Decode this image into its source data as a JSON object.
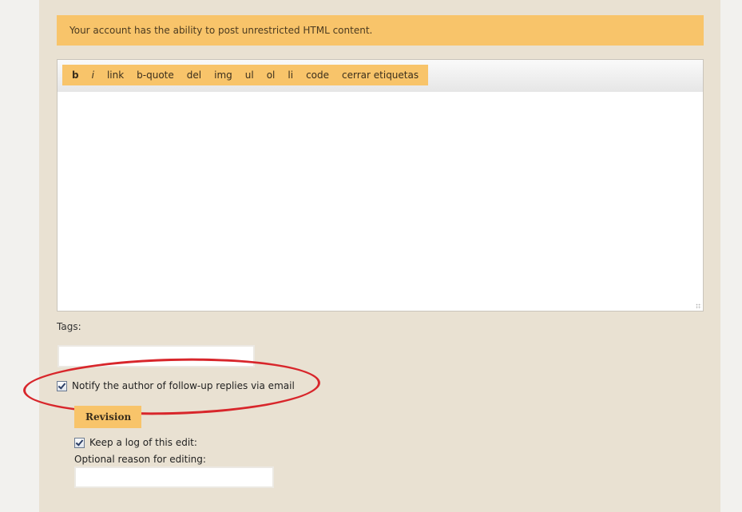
{
  "notice": {
    "text": "Your account has the ability to post unrestricted HTML content."
  },
  "toolbar": {
    "buttons": [
      {
        "label": "b",
        "name": "bold-button"
      },
      {
        "label": "i",
        "name": "italic-button"
      },
      {
        "label": "link",
        "name": "link-button"
      },
      {
        "label": "b-quote",
        "name": "blockquote-button"
      },
      {
        "label": "del",
        "name": "del-button"
      },
      {
        "label": "img",
        "name": "img-button"
      },
      {
        "label": "ul",
        "name": "ul-button"
      },
      {
        "label": "ol",
        "name": "ol-button"
      },
      {
        "label": "li",
        "name": "li-button"
      },
      {
        "label": "code",
        "name": "code-button"
      },
      {
        "label": "cerrar etiquetas",
        "name": "close-tags-button"
      }
    ]
  },
  "editor": {
    "value": ""
  },
  "tags": {
    "label": "Tags:",
    "value": ""
  },
  "notify": {
    "label": "Notify the author of follow-up replies via email",
    "checked": true
  },
  "revision": {
    "tab_label": "Revision",
    "log_label": "Keep a log of this edit:",
    "log_checked": true,
    "reason_label": "Optional reason for editing:",
    "reason_value": ""
  },
  "colors": {
    "accent": "#f8c46a",
    "annotation": "#d8262b",
    "page_background": "#e9e1d2"
  }
}
